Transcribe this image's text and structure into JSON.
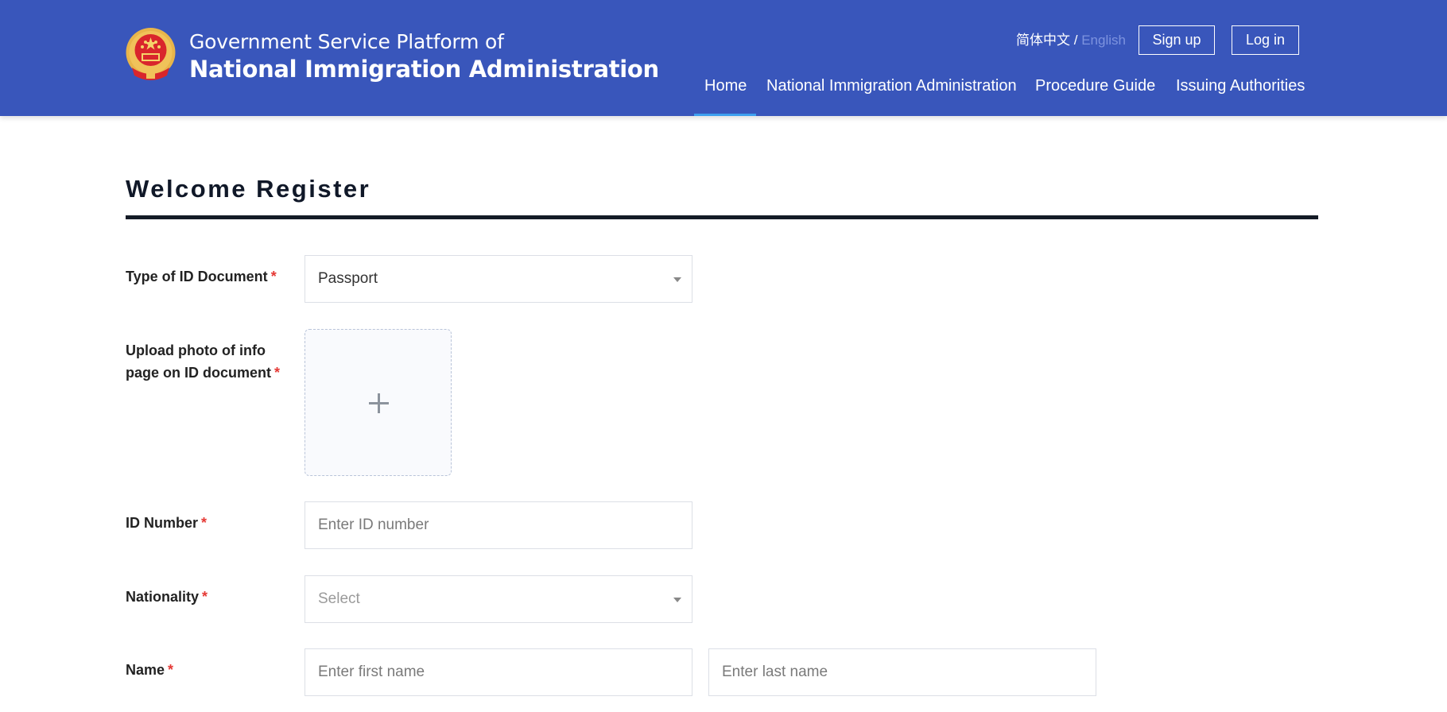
{
  "header": {
    "brand_line1": "Government Service Platform of",
    "brand_line2": "National Immigration Administration",
    "logo_icon": "national-emblem-icon",
    "lang_chinese": "简体中文",
    "lang_separator": "/",
    "lang_english": "English",
    "signup_label": "Sign up",
    "login_label": "Log in",
    "nav": {
      "home": "Home",
      "nia": "National Immigration Administration",
      "guide": "Procedure Guide",
      "issuing": "Issuing Authorities"
    },
    "active_nav": "Home"
  },
  "form": {
    "title": "Welcome Register",
    "required_mark": "*",
    "id_type": {
      "label": "Type of ID Document",
      "value": "Passport"
    },
    "upload": {
      "label_line1": "Upload photo of info",
      "label_line2": "page on ID document",
      "icon": "plus-icon"
    },
    "id_number": {
      "label": "ID Number",
      "placeholder": "Enter ID number"
    },
    "nationality": {
      "label": "Nationality",
      "placeholder": "Select"
    },
    "name": {
      "label": "Name",
      "first_placeholder": "Enter  first name",
      "last_placeholder": "Enter  last name"
    }
  },
  "colors": {
    "header_bg": "#3956bb",
    "nav_active_underline": "#3ea0ef",
    "required": "#e53935",
    "title_rule": "#141b26"
  }
}
